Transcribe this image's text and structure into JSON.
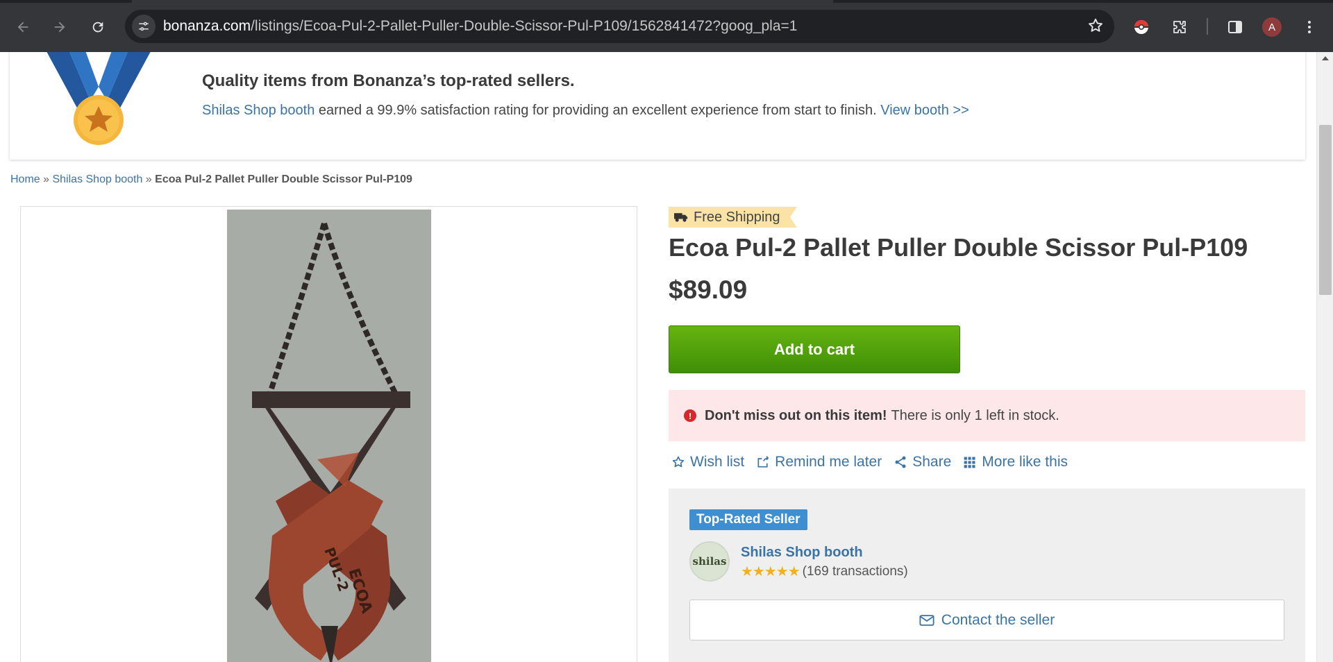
{
  "browser": {
    "url_host": "bonanza.com",
    "url_path": "/listings/Ecoa-Pul-2-Pallet-Puller-Double-Scissor-Pul-P109/1562841472?goog_pla=1",
    "avatar_letter": "A"
  },
  "banner": {
    "title": "Quality items from Bonanza’s top-rated sellers.",
    "seller_link": "Shilas Shop booth",
    "text": " earned a 99.9% satisfaction rating for providing an excellent experience from start to finish. ",
    "view_link": "View booth >>"
  },
  "breadcrumb": {
    "home": "Home",
    "sep1": " » ",
    "booth": "Shilas Shop booth",
    "sep2": " » ",
    "current": "Ecoa Pul-2 Pallet Puller Double Scissor Pul-P109"
  },
  "product": {
    "badge": "Free Shipping",
    "title": "Ecoa Pul-2 Pallet Puller Double Scissor Pul-P109",
    "price": "$89.09",
    "add_to_cart": "Add to cart",
    "image_marking_1": "PUL-2",
    "image_marking_2": "ECOA"
  },
  "stock_alert": {
    "bold": "Don't miss out on this item!",
    "text": "There is only 1 left in stock."
  },
  "actions": {
    "wish_list": "Wish list",
    "remind": "Remind me later",
    "share": "Share",
    "more_like": "More like this"
  },
  "seller": {
    "badge": "Top-Rated Seller",
    "avatar_text": "shilas",
    "name": "Shilas Shop booth",
    "stars": "★★★★★",
    "rating_value": 5,
    "transactions": "(169 transactions)",
    "contact": "Contact the seller"
  },
  "colors": {
    "link": "#3a73a6",
    "cart_green": "#4fa10b",
    "alert_bg": "#fde7e8",
    "badge_blue": "#3d8fd1"
  }
}
